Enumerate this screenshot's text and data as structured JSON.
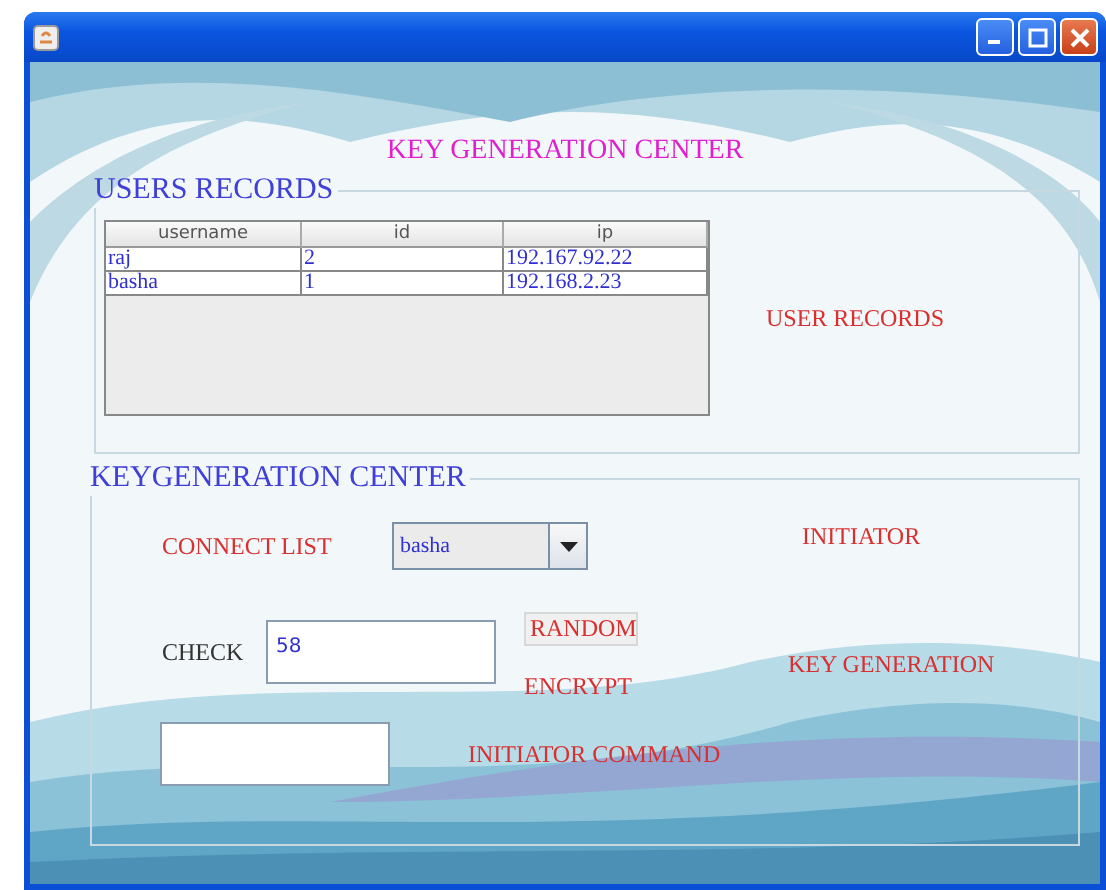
{
  "heading": "KEY GENERATION CENTER",
  "users_records": {
    "legend": "USERS RECORDS",
    "table": {
      "columns": [
        "username",
        "id",
        "ip"
      ],
      "rows": [
        [
          "raj",
          "2",
          "192.167.92.22"
        ],
        [
          "basha",
          "1",
          "192.168.2.23"
        ]
      ]
    },
    "label": "USER RECORDS"
  },
  "key_generation": {
    "legend": "KEYGENERATION CENTER",
    "connect_list": {
      "label": "CONNECT LIST",
      "value": "basha"
    },
    "initiator": "INITIATOR",
    "check": {
      "label": "CHECK",
      "value": "58"
    },
    "random_button": "RANDOM",
    "encrypt": "ENCRYPT",
    "key_generation_label": "KEY GENERATION",
    "initiator_command": "INITIATOR COMMAND"
  }
}
